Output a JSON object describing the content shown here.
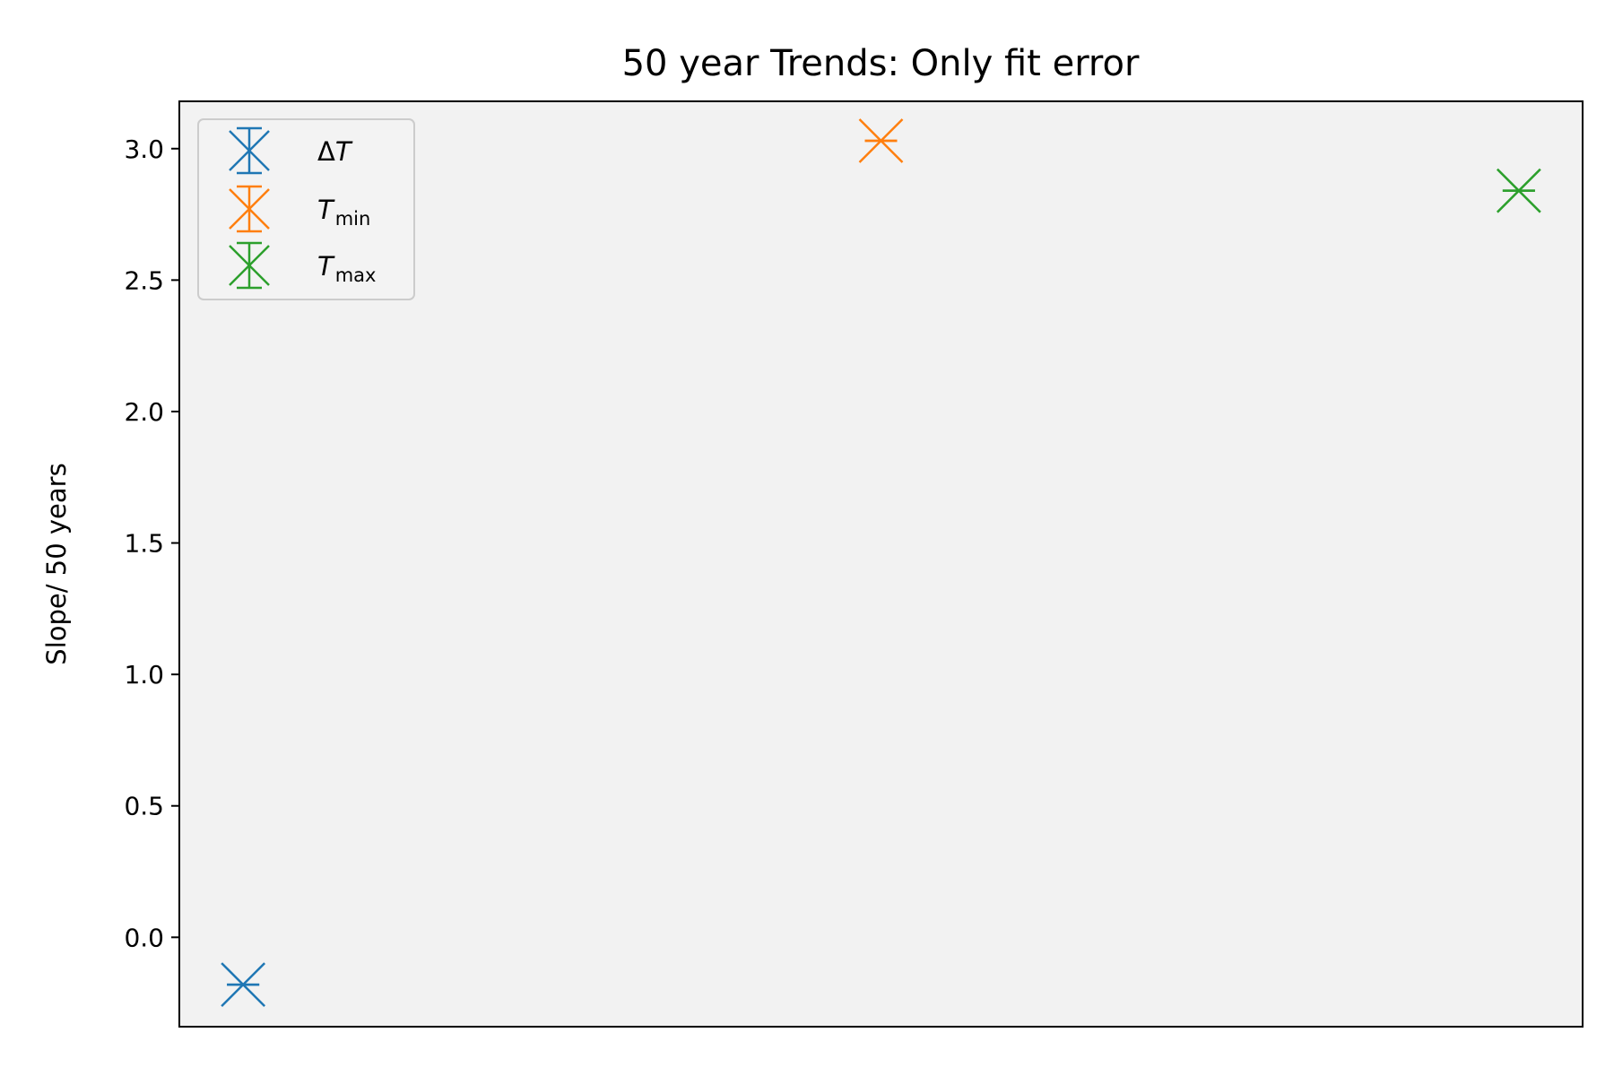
{
  "chart_data": {
    "type": "scatter",
    "title": "50 year Trends: Only fit error",
    "xlabel": "",
    "ylabel": "Slope/ 50 years",
    "ylim": [
      -0.34,
      3.18
    ],
    "xlim": [
      -0.1,
      2.1
    ],
    "yticks": [
      0.0,
      0.5,
      1.0,
      1.5,
      2.0,
      2.5,
      3.0
    ],
    "ytick_labels": [
      "0.0",
      "0.5",
      "1.0",
      "1.5",
      "2.0",
      "2.5",
      "3.0"
    ],
    "xticks_visible": false,
    "grid": false,
    "marker": "x",
    "error_bars": true,
    "legend_position": "upper-left",
    "series": [
      {
        "name": "ΔT",
        "x": 0,
        "y": -0.18,
        "err": 0.0,
        "color": "#1f77b4",
        "legend_main": "ΔT",
        "legend_sub": ""
      },
      {
        "name": "Tmin",
        "x": 1,
        "y": 3.03,
        "err": 0.0,
        "color": "#ff7f0e",
        "legend_main": "T",
        "legend_sub": "min"
      },
      {
        "name": "Tmax",
        "x": 2,
        "y": 2.84,
        "err": 0.0,
        "color": "#2ca02c",
        "legend_main": "T",
        "legend_sub": "max"
      }
    ],
    "axes_background": "#f2f2f2"
  }
}
